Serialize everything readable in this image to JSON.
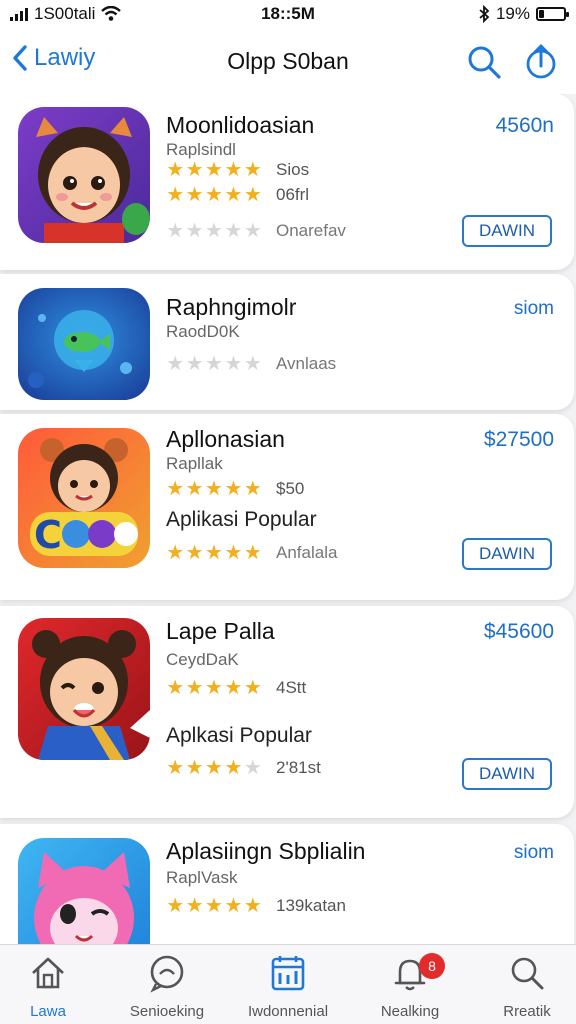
{
  "status_bar": {
    "carrier": "1S00tali",
    "time": "18::5M",
    "battery": "19%",
    "battery_level": 0.19
  },
  "nav": {
    "back_label": "Lawiy",
    "title": "Olpp S0ban"
  },
  "apps": [
    {
      "title": "Moonlidoasian",
      "price": "4560n",
      "subtitle": "Raplsindl",
      "rows": [
        {
          "rating": 5,
          "meta": "Sios"
        },
        {
          "rating": 5,
          "meta": "06frl"
        },
        {
          "rating": 0,
          "meta": "Onarefav"
        }
      ],
      "tagline": "",
      "button": "DAWIN"
    },
    {
      "title": "Raphngimolr",
      "price": "siom",
      "subtitle": "RaodD0K",
      "rows": [
        {
          "rating": 0,
          "meta": "Avnlaas"
        }
      ],
      "tagline": "",
      "button": ""
    },
    {
      "title": "Apllonasian",
      "price": "$27500",
      "subtitle": "Rapllak",
      "rows": [
        {
          "rating": 5,
          "meta": "$50"
        },
        {
          "rating": 5,
          "meta": "Anfalala"
        }
      ],
      "tagline": "Aplikasi Popular",
      "button": "DAWIN"
    },
    {
      "title": "Lape Palla",
      "price": "$45600",
      "subtitle": "CeydDaK",
      "rows": [
        {
          "rating": 5,
          "meta": "4Stt"
        },
        {
          "rating": 4,
          "meta": "2'81st"
        }
      ],
      "tagline": "Aplkasi Popular",
      "button": "DAWIN"
    },
    {
      "title": "Aplasiingn Sbplialin",
      "price": "siom",
      "subtitle": "RaplVask",
      "rows": [
        {
          "rating": 5,
          "meta": "139katan"
        }
      ],
      "tagline": "",
      "button": ""
    }
  ],
  "tabs": [
    {
      "label": "Lawa",
      "icon": "home-icon",
      "active": true
    },
    {
      "label": "Senioeking",
      "icon": "chat-icon",
      "active": false
    },
    {
      "label": "Iwdonnenial",
      "icon": "calendar-icon",
      "active": false
    },
    {
      "label": "Nealking",
      "icon": "bell-icon",
      "active": false,
      "badge": "8"
    },
    {
      "label": "Rreatik",
      "icon": "search-icon",
      "active": false
    }
  ],
  "colors": {
    "accent": "#1e78d8",
    "star": "#f2b01e",
    "badge": "#e22b2b"
  }
}
